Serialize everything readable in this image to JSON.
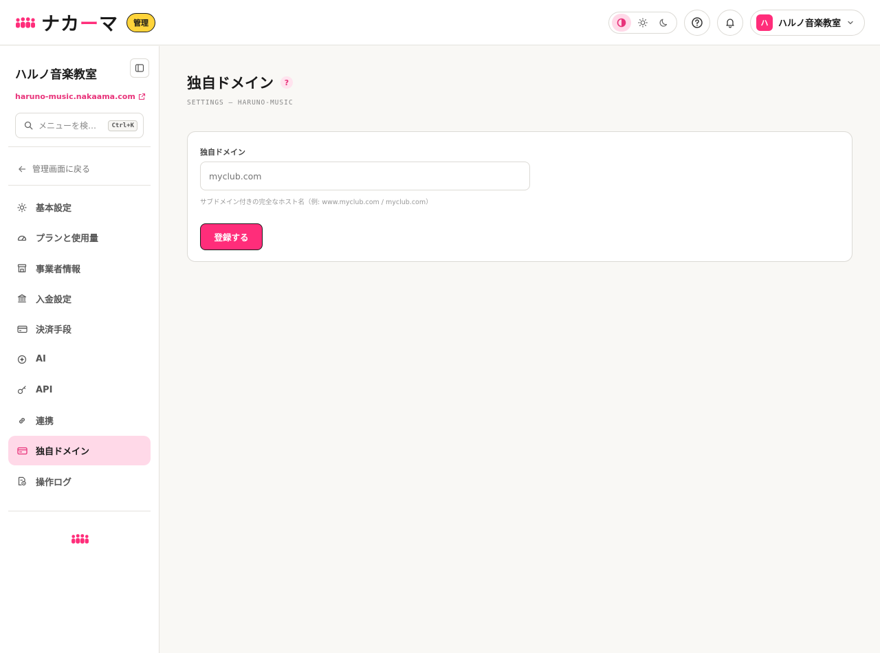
{
  "colors": {
    "accent": "#ff2d7a",
    "accent_soft": "#ffd9e8",
    "badge": "#ffd43b",
    "background": "#f9f8f5"
  },
  "header": {
    "logo_text_a": "ナカ",
    "logo_text_dash": "ー",
    "logo_text_b": "マ",
    "admin_badge": "管理",
    "theme_options": [
      "contrast-icon",
      "sun-icon",
      "moon-icon"
    ],
    "user": {
      "avatar_letter": "ハ",
      "name": "ハルノ音楽教室"
    }
  },
  "sidebar": {
    "org_name": "ハルノ音楽教室",
    "org_url": "haruno-music.nakaama.com",
    "search": {
      "placeholder": "メニューを検…",
      "shortcut": "Ctrl+K"
    },
    "back_label": "管理画面に戻る",
    "items": [
      {
        "label": "基本設定",
        "icon": "sun-icon"
      },
      {
        "label": "プランと使用量",
        "icon": "gauge-icon"
      },
      {
        "label": "事業者情報",
        "icon": "store-icon"
      },
      {
        "label": "入金設定",
        "icon": "bank-icon"
      },
      {
        "label": "決済手段",
        "icon": "credit-card-icon"
      },
      {
        "label": "AI",
        "icon": "ai-icon"
      },
      {
        "label": "API",
        "icon": "key-icon"
      },
      {
        "label": "連携",
        "icon": "link-icon"
      },
      {
        "label": "独自ドメイン",
        "icon": "domain-icon",
        "active": true
      },
      {
        "label": "操作ログ",
        "icon": "log-icon"
      }
    ]
  },
  "main": {
    "title": "独自ドメイン",
    "help": "?",
    "subtitle": "SETTINGS — HARUNO-MUSIC",
    "form": {
      "label": "独自ドメイン",
      "value": "",
      "placeholder": "myclub.com",
      "help": "サブドメイン付きの完全なホスト名（例: www.myclub.com / myclub.com）",
      "submit_label": "登録する"
    }
  }
}
